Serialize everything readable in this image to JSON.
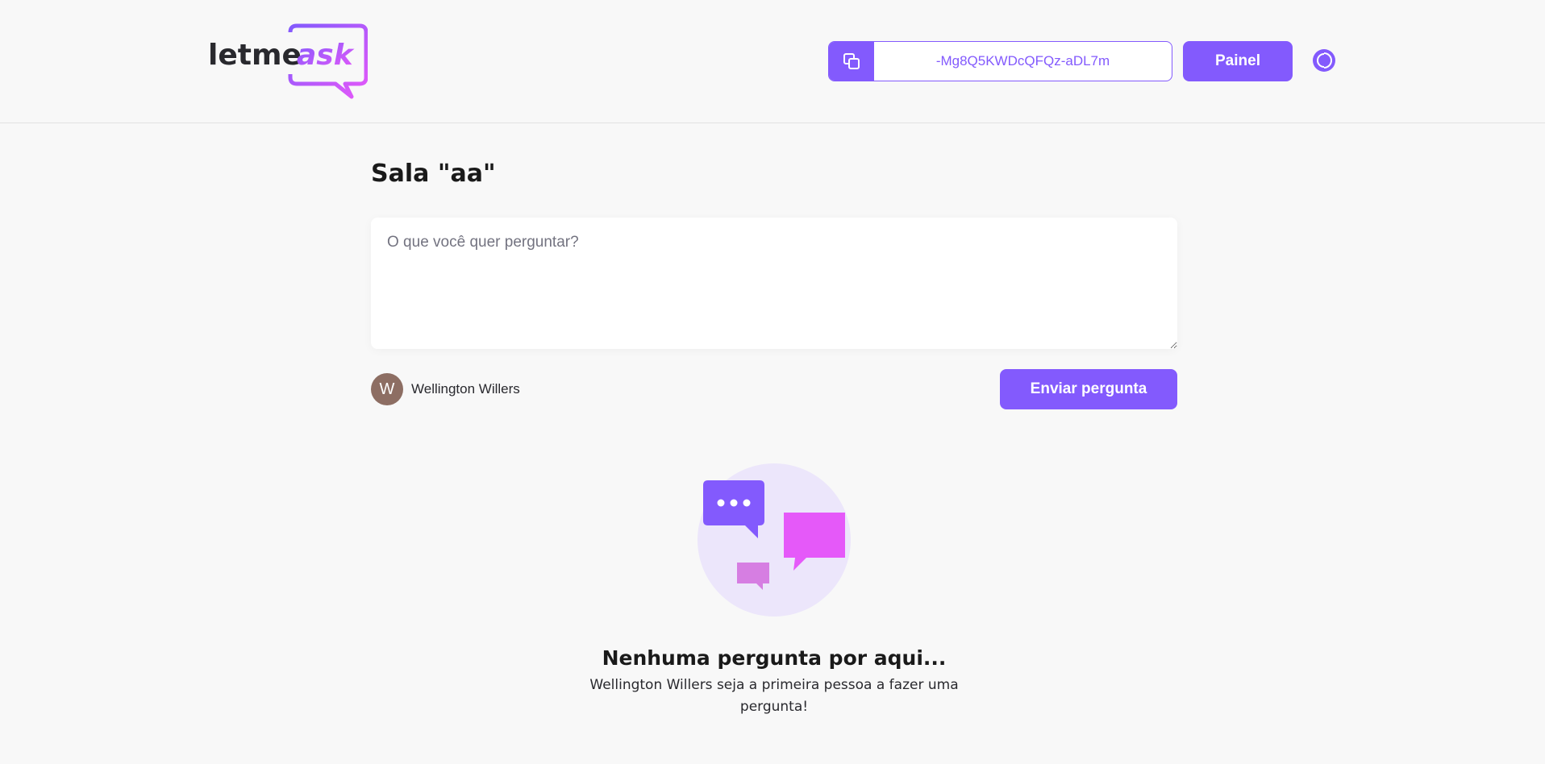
{
  "header": {
    "logo_text_main": "letme",
    "logo_text_accent": "ask",
    "room_code": "-Mg8Q5KWDcQFQz-aDL7m",
    "copy_icon": "copy-icon",
    "panel_button_label": "Painel",
    "theme_icon": "theme-toggle-icon"
  },
  "room": {
    "title": "Sala \"aa\""
  },
  "question_form": {
    "placeholder": "O que você quer perguntar?",
    "value": "",
    "user": {
      "avatar_initial": "W",
      "name": "Wellington Willers"
    },
    "submit_label": "Enviar pergunta"
  },
  "empty_state": {
    "illustration": "empty-questions-illustration",
    "title": "Nenhuma pergunta por aqui...",
    "text": "Wellington Willers seja a primeira pessoa a fazer uma pergunta!"
  },
  "colors": {
    "primary": "#835afd",
    "pink": "#e559f9",
    "background": "#f8f8f8",
    "avatar_bg": "#8d6e63"
  }
}
